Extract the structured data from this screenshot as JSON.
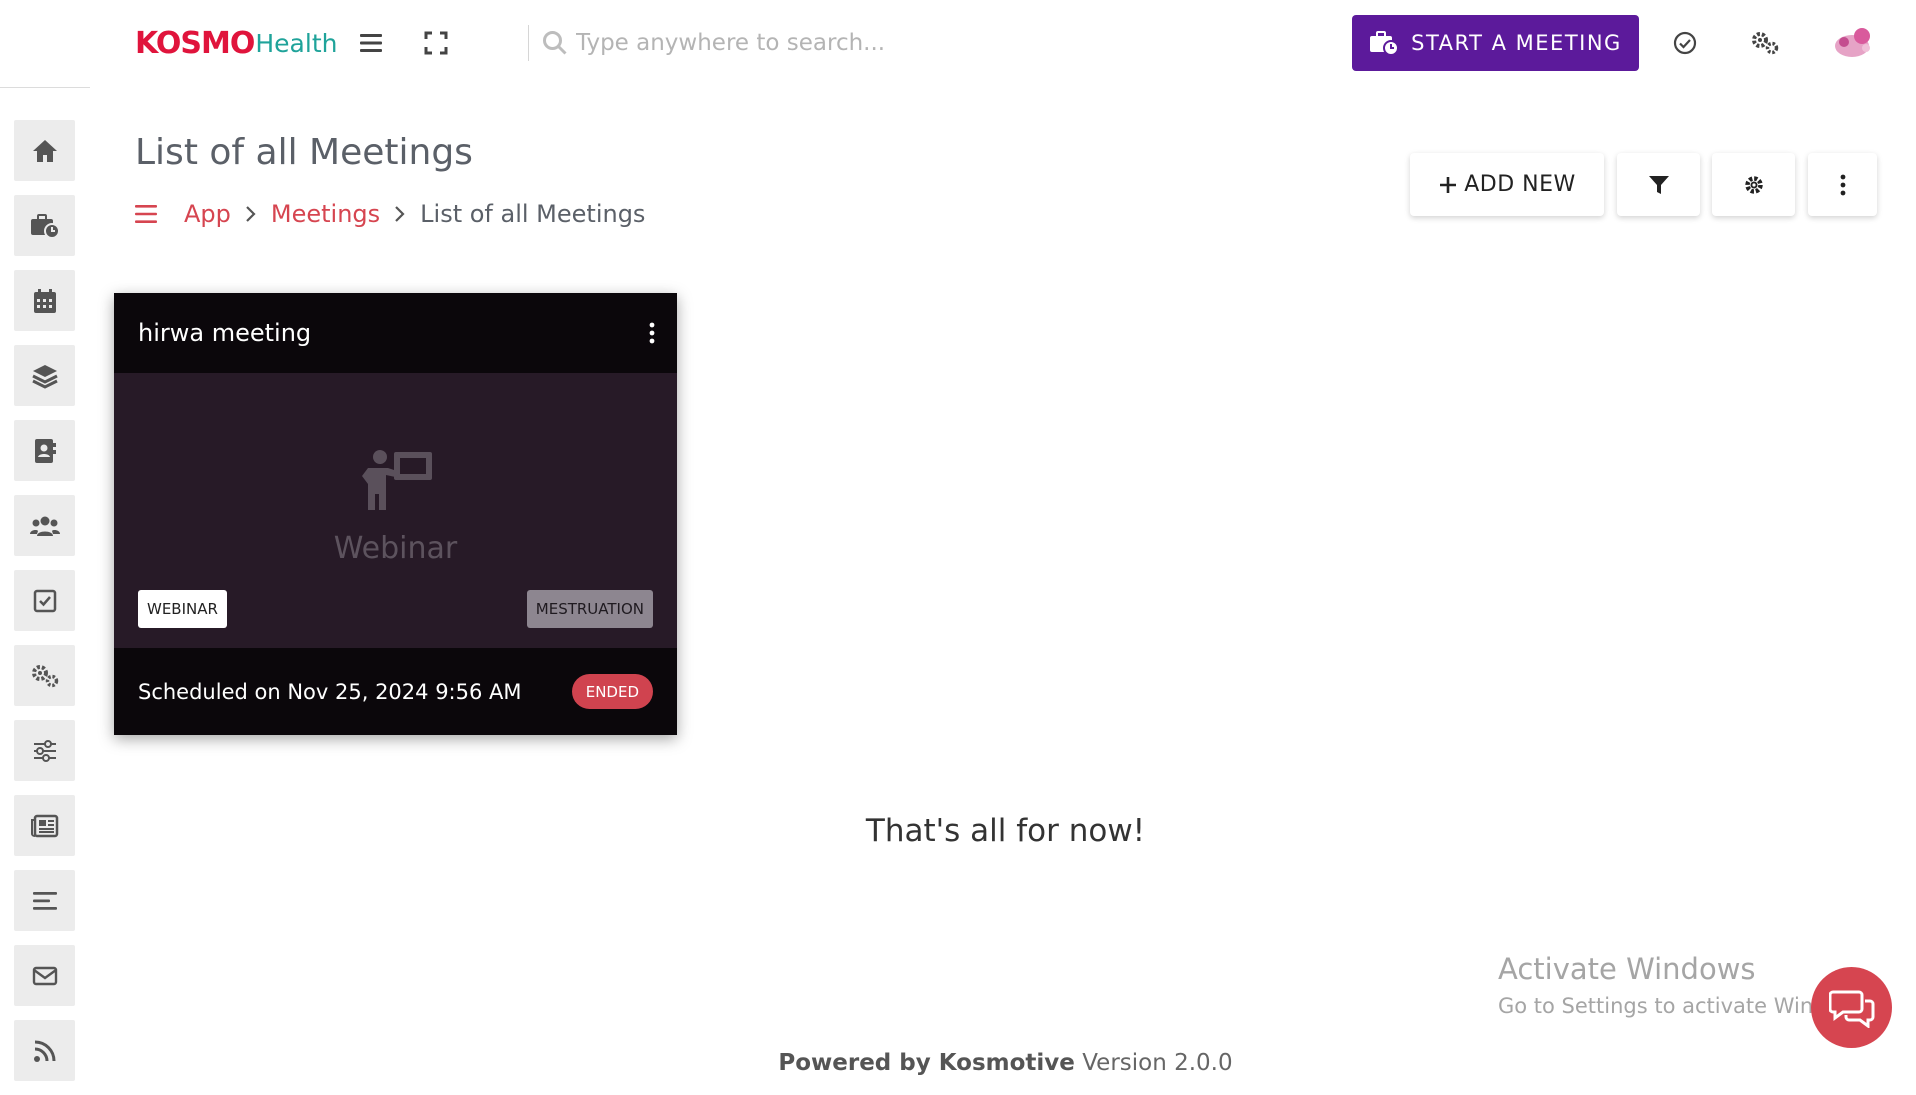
{
  "header": {
    "logo_primary": "KOSMO",
    "logo_secondary": "Health",
    "search_placeholder": "Type anywhere to search...",
    "start_meeting_label": "START A MEETING",
    "icons": [
      "menu-icon",
      "fullscreen-icon",
      "search-icon",
      "check-circle-icon",
      "gears-icon",
      "avatar"
    ]
  },
  "sidebar": {
    "items": [
      {
        "icon": "home-icon"
      },
      {
        "icon": "briefcase-clock-icon"
      },
      {
        "icon": "calendar-icon"
      },
      {
        "icon": "layers-icon"
      },
      {
        "icon": "contact-book-icon"
      },
      {
        "icon": "users-icon"
      },
      {
        "icon": "checkbox-icon"
      },
      {
        "icon": "gears-icon"
      },
      {
        "icon": "sliders-icon"
      },
      {
        "icon": "newspaper-icon"
      },
      {
        "icon": "list-icon"
      },
      {
        "icon": "envelope-icon"
      },
      {
        "icon": "rss-icon"
      }
    ]
  },
  "page": {
    "title": "List of all Meetings",
    "breadcrumb": [
      "App",
      "Meetings",
      "List of all Meetings"
    ],
    "actions": {
      "add_new_label": "ADD NEW"
    }
  },
  "meeting_card": {
    "title": "hirwa meeting",
    "type_label": "Webinar",
    "tag_type": "WEBINAR",
    "tag_topic": "MESTRUATION",
    "schedule_text": "Scheduled on Nov 25, 2024 9:56 AM",
    "status": "ENDED"
  },
  "end_message": "That's all for now!",
  "watermark": {
    "line1": "Activate Windows",
    "line2": "Go to Settings to activate Windows."
  },
  "footer": {
    "powered_prefix": "Powered by",
    "powered_brand": "Kosmotive",
    "version": "Version 2.0.0"
  },
  "colors": {
    "accent": "#5c1a9b",
    "brand_red": "#d64550",
    "card_dark": "#0b070b",
    "card_body": "#271a27"
  }
}
